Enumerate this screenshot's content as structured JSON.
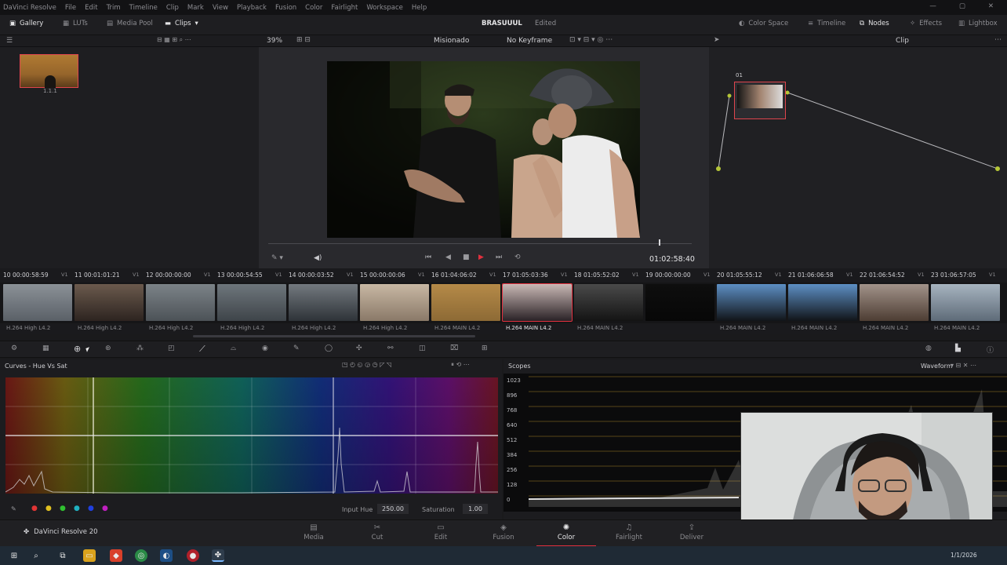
{
  "menu": [
    "DaVinci Resolve",
    "File",
    "Edit",
    "Trim",
    "Timeline",
    "Clip",
    "Mark",
    "View",
    "Playback",
    "Fusion",
    "Color",
    "Fairlight",
    "Workspace",
    "Help"
  ],
  "window_controls": [
    "—",
    "▢",
    "✕"
  ],
  "toolbar": {
    "gallery": "Gallery",
    "luts": "LUTs",
    "media_pool": "Media Pool",
    "clips": "Clips",
    "project_title": "BRASUUUL",
    "project_status": "Edited",
    "color_space": "Color Space",
    "timeline": "Timeline",
    "nodes": "Nodes",
    "effects": "Effects",
    "lightbox": "Lightbox"
  },
  "viewer": {
    "zoom": "39%",
    "title": "Misionado",
    "keyframe": "No Keyframe",
    "timecode": "01:02:58:40",
    "clip_mode": "Clip"
  },
  "gallery": {
    "still_label": "1.1.1"
  },
  "clips": [
    {
      "num": "10",
      "tc": "00:00:58:59",
      "track": "V1",
      "codec": "H.264 High L4.2",
      "c1": "#5a6067",
      "c2": "#8b9197"
    },
    {
      "num": "11",
      "tc": "00:01:01:21",
      "track": "V1",
      "codec": "H.264 High L4.2",
      "c1": "#2d2420",
      "c2": "#6b5a4d"
    },
    {
      "num": "12",
      "tc": "00:00:00:00",
      "track": "V1",
      "codec": "H.264 High L4.2",
      "c1": "#4c5257",
      "c2": "#7c8388"
    },
    {
      "num": "13",
      "tc": "00:00:54:55",
      "track": "V1",
      "codec": "H.264 High L4.2",
      "c1": "#3e4449",
      "c2": "#6e767c"
    },
    {
      "num": "14",
      "tc": "00:00:03:52",
      "track": "V1",
      "codec": "H.264 High L4.2",
      "c1": "#2e3338",
      "c2": "#73797f"
    },
    {
      "num": "15",
      "tc": "00:00:00:06",
      "track": "V1",
      "codec": "H.264 High L4.2",
      "c1": "#8a7968",
      "c2": "#c8b8a4"
    },
    {
      "num": "16",
      "tc": "01:04:06:02",
      "track": "V1",
      "codec": "H.264 MAIN L4.2",
      "c1": "#8d6a35",
      "c2": "#b58a48"
    },
    {
      "num": "17",
      "tc": "01:05:03:36",
      "track": "V1",
      "codec": "H.264 MAIN L4.2",
      "c1": "#2a2226",
      "c2": "#c9b8b5"
    },
    {
      "num": "18",
      "tc": "01:05:52:02",
      "track": "V1",
      "codec": "H.264 MAIN L4.2",
      "c1": "#141414",
      "c2": "#4a4a4a"
    },
    {
      "num": "19",
      "tc": "00:00:00:00",
      "track": "V1",
      "codec": "",
      "c1": "#070707",
      "c2": "#0e0e0e"
    },
    {
      "num": "20",
      "tc": "01:05:55:12",
      "track": "V1",
      "codec": "H.264 MAIN L4.2",
      "c1": "#111418",
      "c2": "#5d8fc4"
    },
    {
      "num": "21",
      "tc": "01:06:06:58",
      "track": "V1",
      "codec": "H.264 MAIN L4.2",
      "c1": "#111418",
      "c2": "#5d8fc4"
    },
    {
      "num": "22",
      "tc": "01:06:54:52",
      "track": "V1",
      "codec": "H.264 MAIN L4.2",
      "c1": "#4d3d33",
      "c2": "#a2938a"
    },
    {
      "num": "23",
      "tc": "01:06:57:05",
      "track": "V1",
      "codec": "H.264 MAIN L4.2",
      "c1": "#5e6b78",
      "c2": "#a7b4c0"
    }
  ],
  "curves": {
    "title": "Curves - Hue Vs Sat",
    "input_hue_label": "Input Hue",
    "input_hue_value": "250.00",
    "saturation_label": "Saturation",
    "saturation_value": "1.00"
  },
  "scopes": {
    "title": "Scopes",
    "mode": "Waveform",
    "ticks": [
      "1023",
      "896",
      "768",
      "640",
      "512",
      "384",
      "256",
      "128",
      "0"
    ]
  },
  "pages": [
    {
      "label": "Media",
      "icon": "▤"
    },
    {
      "label": "Cut",
      "icon": "✂"
    },
    {
      "label": "Edit",
      "icon": "▭"
    },
    {
      "label": "Fusion",
      "icon": "◈"
    },
    {
      "label": "Color",
      "icon": "✺"
    },
    {
      "label": "Fairlight",
      "icon": "♫"
    },
    {
      "label": "Deliver",
      "icon": "⇪"
    }
  ],
  "app_name": "DaVinci Resolve 20",
  "taskbar": {
    "clock": "1/1/2026",
    "colors": {
      "accent": "#e2303e",
      "active_page": "#e2303e"
    }
  }
}
